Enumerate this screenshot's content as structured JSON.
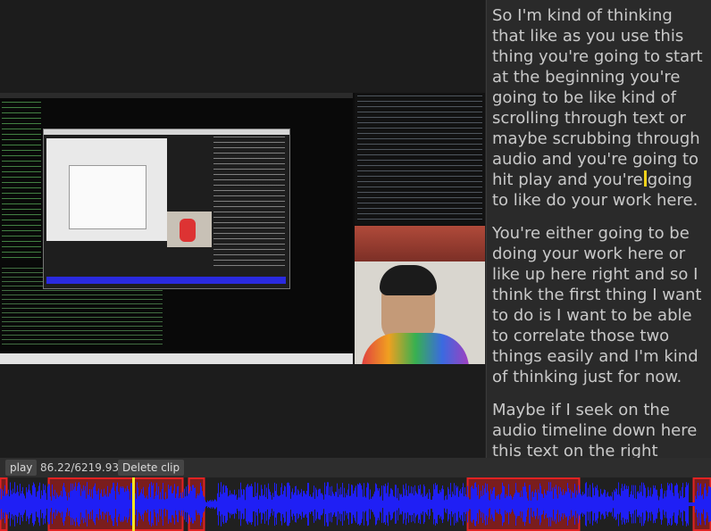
{
  "video": {
    "description_icons": [
      "terminal-icon",
      "browser-icon"
    ]
  },
  "transcript": {
    "paragraphs": [
      {
        "before_cursor": "So I'm kind of thinking that like as you use this thing you're going to start at the beginning you're going to be like kind of scrolling through text or maybe scrubbing through audio and you're going to hit play and you're",
        "after_cursor": "going to like do your work here."
      },
      {
        "before_cursor": "You're either going to be doing your work here or like up here right and so I think the first thing I want to do is I want to be able to correlate those two things easily and I'm kind of thinking just for now.",
        "after_cursor": ""
      },
      {
        "before_cursor": "Maybe if I seek on the audio timeline down here this text on the right",
        "after_cursor": ""
      }
    ]
  },
  "controls": {
    "play_label": "play",
    "time_readout": "86.22/6219.93",
    "delete_label": "Delete clip"
  },
  "timeline": {
    "duration": 6219.93,
    "current_time": 86.22,
    "colors": {
      "waveform": "#1f1ff5",
      "clip_fill": "#7a1d1d",
      "clip_border": "#e12222",
      "playhead": "#f7e61e"
    },
    "clips": [
      {
        "start": 0,
        "end": 8
      },
      {
        "start": 54,
        "end": 205
      },
      {
        "start": 211,
        "end": 229
      },
      {
        "start": 523,
        "end": 649
      },
      {
        "start": 776,
        "end": 796
      }
    ],
    "clip_units": "timeline-px-of-796"
  }
}
